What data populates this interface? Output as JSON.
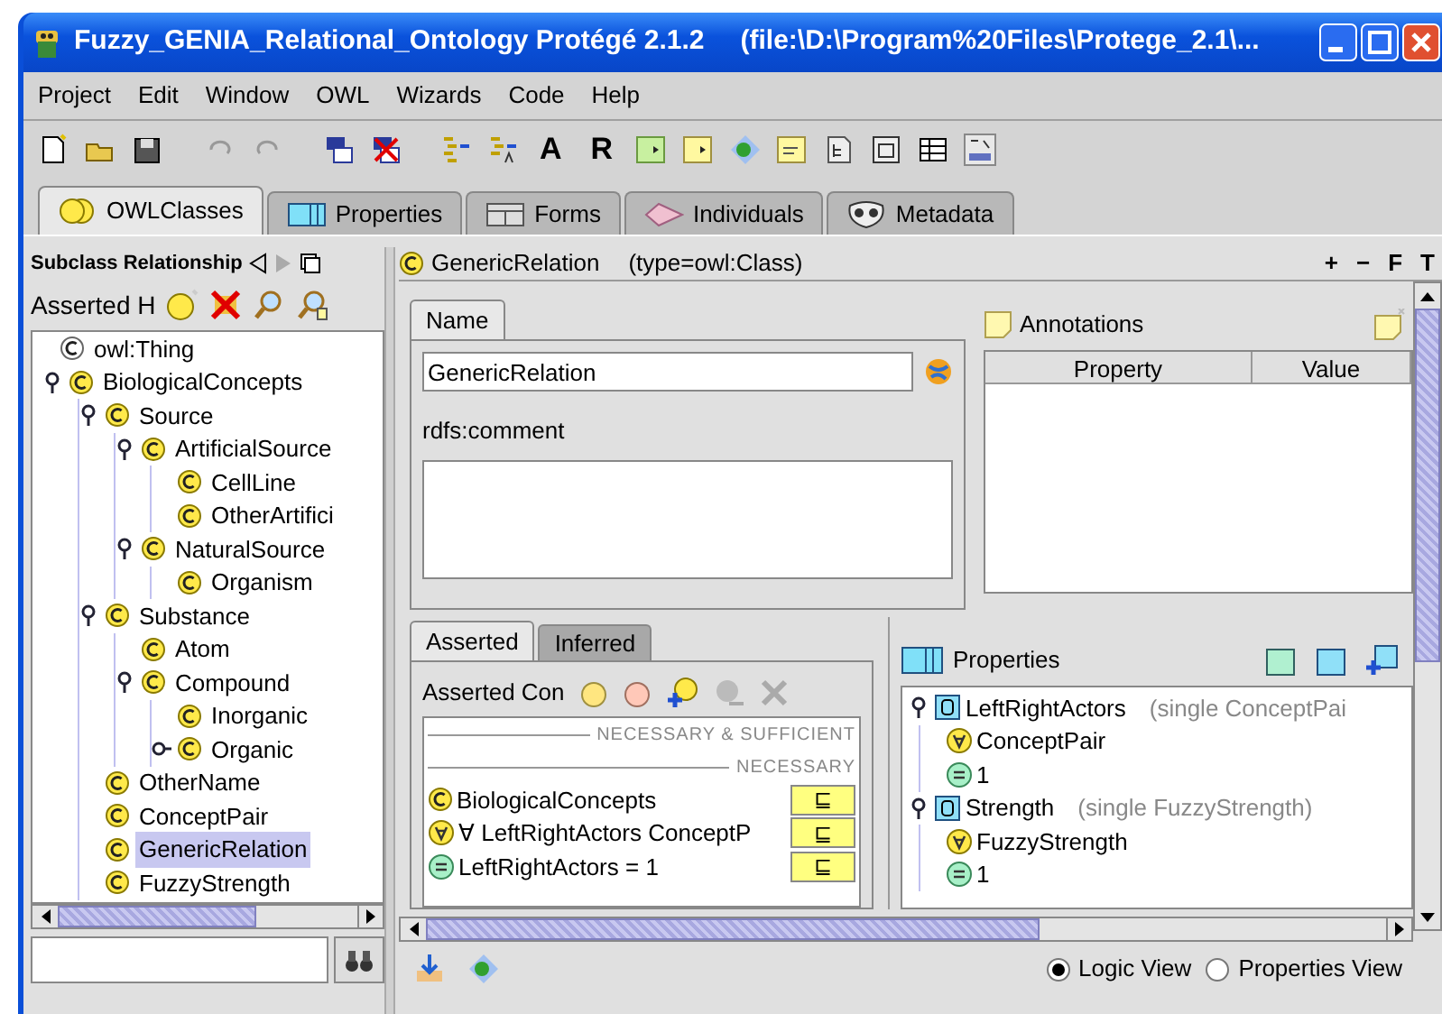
{
  "window": {
    "title": "Fuzzy_GENIA_Relational_Ontology  Protégé 2.1.2",
    "path": "(file:\\D:\\Program%20Files\\Protege_2.1\\..."
  },
  "menu": [
    "Project",
    "Edit",
    "Window",
    "OWL",
    "Wizards",
    "Code",
    "Help"
  ],
  "toolbar_text_buttons": [
    "A",
    "R"
  ],
  "tabs": [
    {
      "label": "OWLClasses",
      "selected": true
    },
    {
      "label": "Properties",
      "selected": false
    },
    {
      "label": "Forms",
      "selected": false
    },
    {
      "label": "Individuals",
      "selected": false
    },
    {
      "label": "Metadata",
      "selected": false
    }
  ],
  "class_browser": {
    "header": "Subclass Relationship",
    "hierarchy_label": "Asserted H",
    "tree": [
      {
        "label": "owl:Thing",
        "kind": "root",
        "selected": false,
        "children": [
          {
            "label": "BiologicalConcepts",
            "kind": "class",
            "expanded": true,
            "selected": false,
            "children": [
              {
                "label": "Source",
                "kind": "class",
                "expanded": true,
                "selected": false,
                "children": [
                  {
                    "label": "ArtificialSource",
                    "kind": "class",
                    "expanded": true,
                    "selected": false,
                    "children": [
                      {
                        "label": "CellLine",
                        "kind": "class",
                        "selected": false
                      },
                      {
                        "label": "OtherArtifici",
                        "kind": "class",
                        "selected": false
                      }
                    ]
                  },
                  {
                    "label": "NaturalSource",
                    "kind": "class",
                    "expanded": true,
                    "selected": false,
                    "children": [
                      {
                        "label": "Organism",
                        "kind": "class",
                        "selected": false
                      }
                    ]
                  }
                ]
              },
              {
                "label": "Substance",
                "kind": "class",
                "expanded": true,
                "selected": false,
                "children": [
                  {
                    "label": "Atom",
                    "kind": "class",
                    "selected": false
                  },
                  {
                    "label": "Compound",
                    "kind": "class",
                    "expanded": true,
                    "selected": false,
                    "children": [
                      {
                        "label": "Inorganic",
                        "kind": "class",
                        "selected": false
                      },
                      {
                        "label": "Organic",
                        "kind": "class",
                        "expanded": false,
                        "selected": false
                      }
                    ]
                  }
                ]
              },
              {
                "label": "OtherName",
                "kind": "class",
                "selected": false
              },
              {
                "label": "ConceptPair",
                "kind": "class",
                "selected": false
              },
              {
                "label": "GenericRelation",
                "kind": "class",
                "selected": true
              },
              {
                "label": "FuzzyStrength",
                "kind": "class",
                "selected": false
              }
            ]
          }
        ]
      }
    ]
  },
  "class_header": {
    "name": "GenericRelation",
    "type": "(type=owl:Class)",
    "actions": [
      "+",
      "−",
      "F",
      "T"
    ]
  },
  "name_panel": {
    "tab": "Name",
    "value": "GenericRelation",
    "comment_label": "rdfs:comment"
  },
  "annotations": {
    "title": "Annotations",
    "columns": [
      "Property",
      "Value"
    ]
  },
  "conditions": {
    "tabs": [
      {
        "label": "Asserted",
        "selected": true
      },
      {
        "label": "Inferred",
        "selected": false
      }
    ],
    "label": "Asserted Con",
    "sections": [
      {
        "title": "NECESSARY & SUFFICIENT"
      },
      {
        "title": "NECESSARY",
        "rows": [
          {
            "kind": "class",
            "text": "BiologicalConcepts",
            "badge": "⊑"
          },
          {
            "kind": "all",
            "text": "∀ LeftRightActors ConceptP",
            "badge": "⊑"
          },
          {
            "kind": "card",
            "text": "LeftRightActors = 1",
            "badge": "⊑"
          }
        ]
      }
    ]
  },
  "properties": {
    "title": "Properties",
    "tree": [
      {
        "label": "LeftRightActors",
        "note": "(single ConceptPai",
        "children": [
          {
            "kind": "all",
            "label": "ConceptPair"
          },
          {
            "kind": "card",
            "label": "1"
          }
        ]
      },
      {
        "label": "Strength",
        "note": "(single FuzzyStrength)",
        "children": [
          {
            "kind": "all",
            "label": "FuzzyStrength"
          },
          {
            "kind": "card",
            "label": "1"
          }
        ]
      }
    ]
  },
  "view_options": [
    {
      "label": "Logic View",
      "selected": true
    },
    {
      "label": "Properties View",
      "selected": false
    }
  ]
}
